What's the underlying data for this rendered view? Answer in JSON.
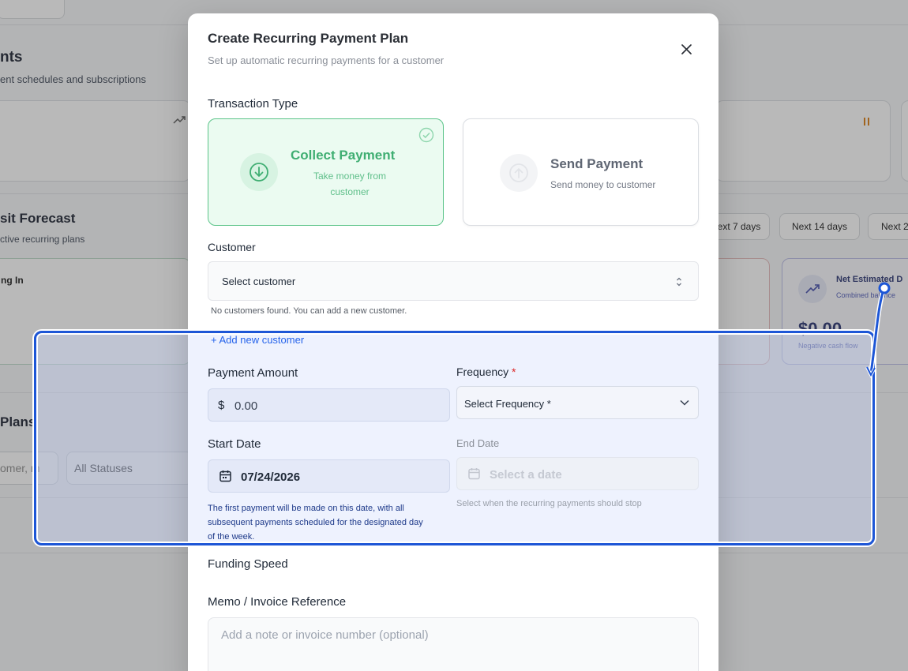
{
  "background": {
    "section_title_1": "nts",
    "section_sub_1": "ent schedules and subscriptions",
    "forecast_title": "sit Forecast",
    "forecast_sub": "ctive recurring plans",
    "coming_in_label": "ng In",
    "range_chips": [
      "ext 7 days",
      "Next 14 days",
      "Next 2"
    ],
    "net_card_title": "Net Estimated D",
    "net_card_sub": "Combined balance",
    "net_card_value": "$0.00",
    "net_card_note": "Negative cash flow",
    "plans_title": "Plans",
    "search_placeholder": "omer, m",
    "status_filter": "All Statuses"
  },
  "modal": {
    "title": "Create Recurring Payment Plan",
    "subtitle": "Set up automatic recurring payments for a customer",
    "transaction_type_label": "Transaction Type",
    "collect": {
      "name": "Collect Payment",
      "desc_line1": "Take money from",
      "desc_line2": "customer"
    },
    "send": {
      "name": "Send Payment",
      "desc": "Send money to customer"
    },
    "customer_label": "Customer",
    "customer_placeholder": "Select customer",
    "customer_hint": "No customers found. You can add a new customer.",
    "add_customer_link": "+ Add new customer",
    "amount_label": "Payment Amount",
    "amount_currency": "$",
    "amount_value": "0.00",
    "frequency_label": "Frequency",
    "required_mark": "*",
    "frequency_placeholder": "Select Frequency *",
    "start_date_label": "Start Date",
    "start_date_value": "07/24/2026",
    "start_date_hint_1": "The first payment will be made on this date, with all",
    "start_date_hint_2": "subsequent payments scheduled for the designated day",
    "start_date_hint_3": "of the week.",
    "end_date_label": "End Date",
    "end_date_placeholder": "Select a date",
    "end_date_hint": "Select when the recurring payments should stop",
    "funding_speed_label": "Funding Speed",
    "memo_label": "Memo / Invoice Reference",
    "memo_placeholder": "Add a note or invoice number (optional)"
  },
  "colors": {
    "accent_green": "#3fae72",
    "highlight_blue": "#1d56d6",
    "link_blue": "#2563eb",
    "required_red": "#dc2626"
  }
}
